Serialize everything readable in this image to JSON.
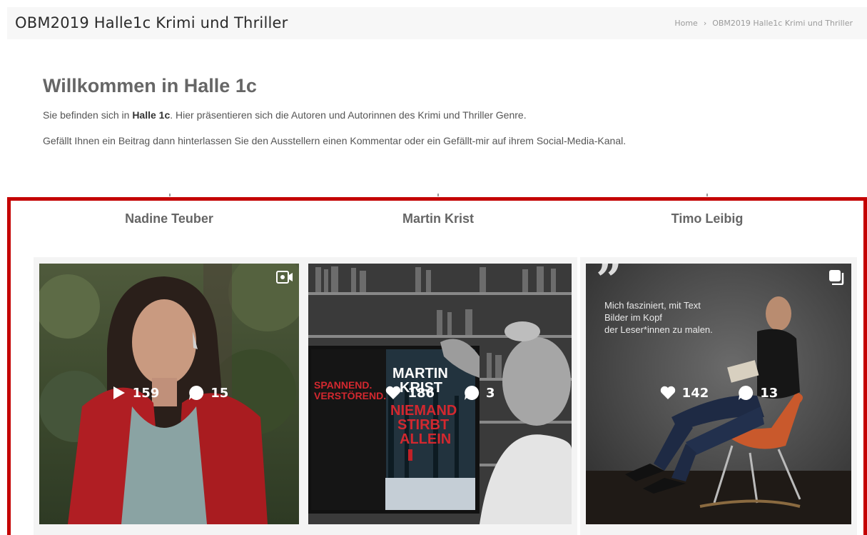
{
  "header": {
    "title": "OBM2019 Halle1c Krimi und Thriller",
    "breadcrumb": {
      "home": "Home",
      "separator": "›",
      "current": "OBM2019 Halle1c Krimi und Thriller"
    }
  },
  "intro": {
    "heading": "Willkommen in Halle 1c",
    "line1_prefix": "Sie befinden sich in ",
    "line1_bold": "Halle 1c",
    "line1_suffix": ". Hier präsentieren sich die Autoren und Autorinnen des Krimi und Thriller Genre.",
    "line2": "Gefällt Ihnen ein Beitrag dann hinterlassen Sie den Ausstellern einen Kommentar oder ein Gefällt-mir auf ihrem Social-Media-Kanal."
  },
  "colors": {
    "frame": "#c40000",
    "header_bg": "#f7f7f7"
  },
  "authors": [
    {
      "name": "Nadine Teuber",
      "primary_icon": "play-icon",
      "primary_count": "159",
      "comment_count": "15",
      "corner_icon": "video-icon"
    },
    {
      "name": "Martin Krist",
      "primary_icon": "heart-icon",
      "primary_count": "186",
      "comment_count": "3",
      "corner_icon": "",
      "book_title": "MARTIN KRIST",
      "book_subtitle": "NIEMAND STIRBT ALLEIN"
    },
    {
      "name": "Timo Leibig",
      "primary_icon": "heart-icon",
      "primary_count": "142",
      "comment_count": "13",
      "corner_icon": "gallery-icon",
      "quote": "Mich fasziniert, mit Text\nBilder im Kopf\nder Leser*innen zu malen."
    }
  ]
}
